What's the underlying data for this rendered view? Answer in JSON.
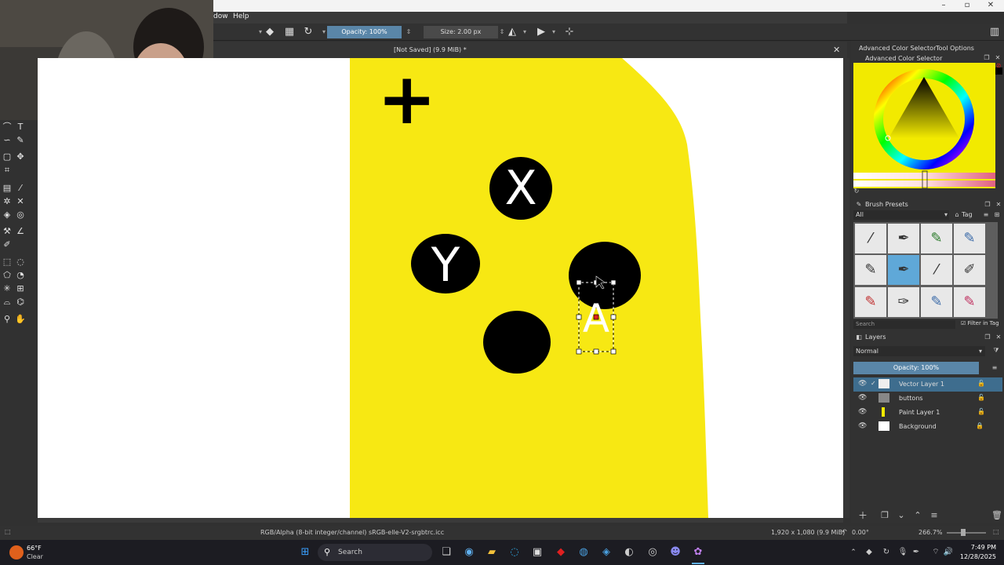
{
  "menubar": {
    "items": [
      "dow",
      "Help"
    ]
  },
  "toolbar": {
    "opacity_label": "Opacity: 100%",
    "size_label": "Size: 2.00 px"
  },
  "document": {
    "title": "[Not Saved]  (9.9 MiB) *"
  },
  "canvas": {
    "buttons": [
      {
        "label": "X"
      },
      {
        "label": "Y"
      },
      {
        "label": ""
      },
      {
        "label": ""
      }
    ],
    "selected_text": "A",
    "dpad_symbol": "+",
    "colors": {
      "background": "#f7e813",
      "button": "#000000",
      "selection": "#ffffff"
    }
  },
  "right_dock": {
    "tabs": [
      "Advanced Color Selector",
      "Tool Options"
    ],
    "color_selector_title": "Advanced Color Selector",
    "brush_presets": {
      "title": "Brush Presets",
      "filter_all": "All",
      "tag_label": "Tag",
      "search_placeholder": "Search",
      "filter_in_tag": "Filter in Tag"
    },
    "layers": {
      "title": "Layers",
      "blend_mode": "Normal",
      "opacity": "Opacity:  100%",
      "items": [
        {
          "name": "Vector Layer 1"
        },
        {
          "name": "buttons"
        },
        {
          "name": "Paint Layer 1"
        },
        {
          "name": "Background"
        }
      ]
    }
  },
  "status_bar": {
    "color_profile": "RGB/Alpha (8-bit integer/channel)  sRGB-elle-V2-srgbtrc.icc",
    "image_size": "1,920 x 1,080 (9.9 MiB)",
    "rotation": "0.00°",
    "zoom": "266.7%"
  },
  "taskbar": {
    "weather_temp": "66°F",
    "weather_desc": "Clear",
    "search_placeholder": "Search",
    "time": "7:49 PM",
    "date": "12/28/2025"
  }
}
